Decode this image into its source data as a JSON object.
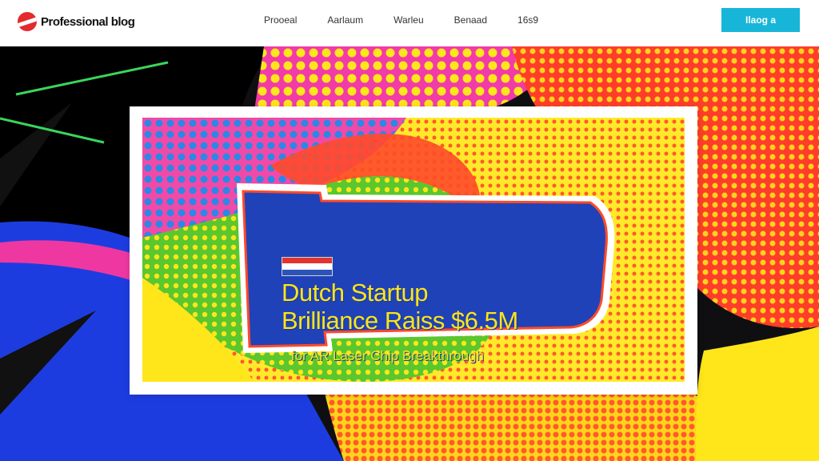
{
  "header": {
    "logo_text": "Professional blog",
    "nav": [
      "Prooeal",
      "Aarlaum",
      "Warleu",
      "Benaad",
      "16s9"
    ],
    "cta_label": "Ilaog a"
  },
  "hero": {
    "headline_line1": "Dutch Startup",
    "headline_line2": "Brilliance Raiss $6.5M",
    "subheadline": "for AR Laser Chip Breakthrough",
    "flag_colors": [
      "#e0342f",
      "#ffffff",
      "#2c54b8"
    ]
  },
  "colors": {
    "blue": "#1f3bd6",
    "yellow": "#ffe61a",
    "pink": "#f23aa8",
    "green": "#55c52a",
    "orange": "#ff6a22",
    "cyan": "#17b6d8"
  }
}
